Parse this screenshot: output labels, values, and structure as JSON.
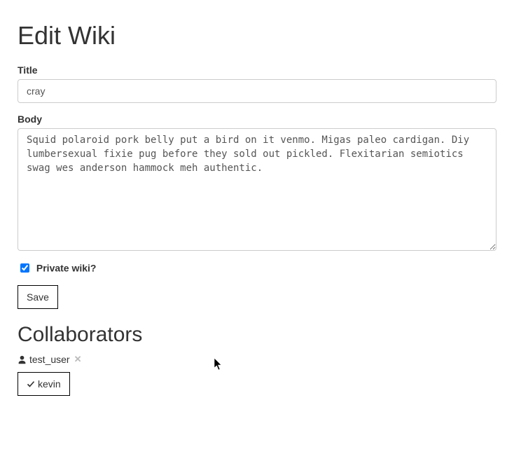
{
  "page": {
    "heading": "Edit Wiki"
  },
  "form": {
    "title_label": "Title",
    "title_value": "cray",
    "body_label": "Body",
    "body_value": "Squid polaroid pork belly put a bird on it venmo. Migas paleo cardigan. Diy lumbersexual fixie pug before they sold out pickled. Flexitarian semiotics swag wes anderson hammock meh authentic.",
    "private_label": "Private wiki?",
    "private_checked": true,
    "save_label": "Save"
  },
  "collaborators": {
    "heading": "Collaborators",
    "items": [
      {
        "name": "test_user"
      }
    ],
    "add_candidate": "kevin"
  }
}
